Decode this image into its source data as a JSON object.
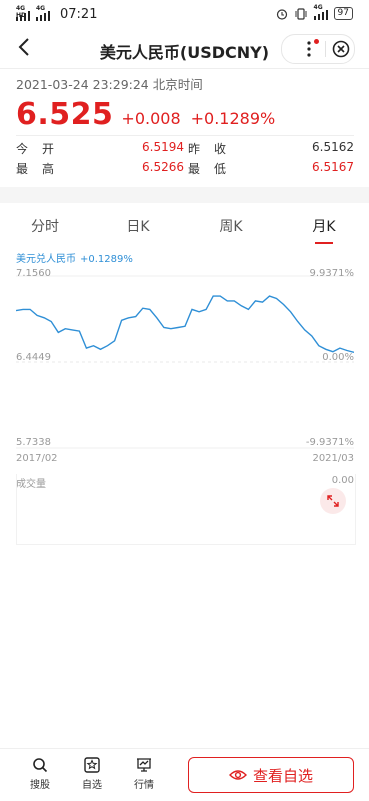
{
  "status_bar": {
    "net1": "4G HD",
    "net2": "4G",
    "time": "07:21",
    "net3": "4G",
    "battery": "97"
  },
  "nav": {
    "title": "美元人民币(USDCNY)"
  },
  "quote": {
    "datetime": "2021-03-24 23:29:24 北京时间",
    "price": "6.525",
    "change": "+0.008",
    "change_pct": "+0.1289%",
    "stats": [
      {
        "k1": "今开",
        "v1": "6.5194",
        "k2": "昨收",
        "v2": "6.5162"
      },
      {
        "k1": "最高",
        "v1": "6.5266",
        "k2": "最低",
        "v2": "6.5167"
      }
    ]
  },
  "tabs": [
    "分时",
    "日K",
    "周K",
    "月K"
  ],
  "active_tab": "月K",
  "chart_legend": {
    "name": "美元兑人民币",
    "pct": "+0.1289%"
  },
  "chart_data": {
    "type": "line",
    "x_start": "2017/02",
    "x_end": "2021/03",
    "y_left_ticks": [
      "7.1560",
      "6.4449",
      "5.7338"
    ],
    "y_right_ticks": [
      "9.9371%",
      "0.00%",
      "-9.9371%"
    ],
    "ylim": [
      5.7338,
      7.156
    ],
    "series": [
      {
        "values": [
          6.87,
          6.88,
          6.88,
          6.83,
          6.81,
          6.78,
          6.69,
          6.72,
          6.71,
          6.7,
          6.56,
          6.58,
          6.55,
          6.58,
          6.62,
          6.79,
          6.81,
          6.82,
          6.89,
          6.88,
          6.81,
          6.73,
          6.72,
          6.73,
          6.74,
          6.88,
          6.86,
          6.88,
          6.99,
          6.99,
          6.95,
          6.95,
          6.91,
          6.88,
          6.95,
          6.94,
          6.99,
          6.97,
          6.92,
          6.86,
          6.78,
          6.71,
          6.66,
          6.58,
          6.55,
          6.53,
          6.56,
          6.54,
          6.525
        ]
      }
    ],
    "color": "#2f8fd6"
  },
  "volume": {
    "label": "成交量",
    "value": "0.00"
  },
  "bottom_bar": {
    "items": [
      "搜股",
      "自选",
      "行情"
    ],
    "watch_label": "查看自选"
  },
  "colors": {
    "up": "#e02020",
    "line": "#2f8fd6"
  }
}
